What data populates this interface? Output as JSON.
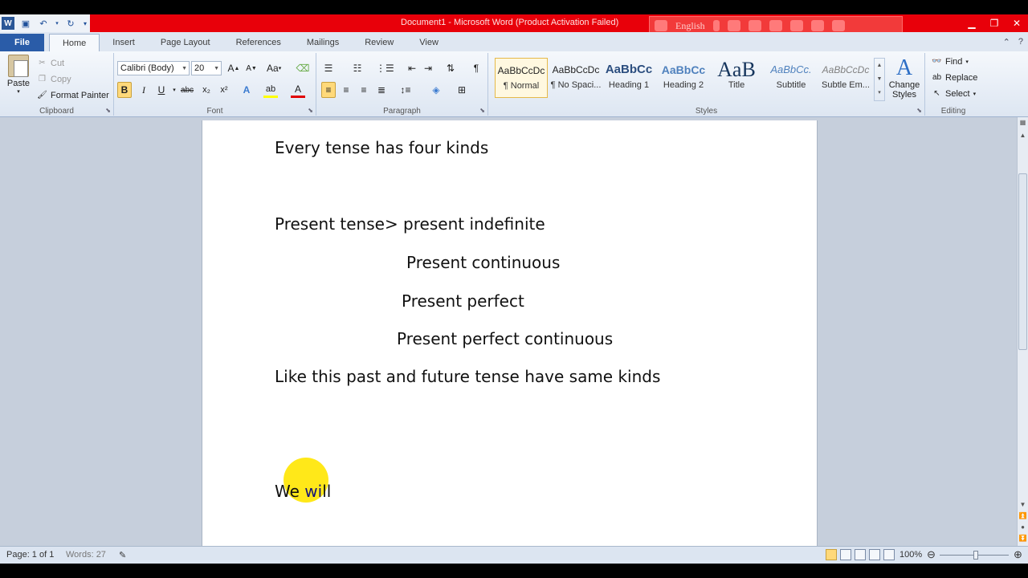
{
  "title_bar": {
    "title": "Document1  -  Microsoft Word (Product Activation Failed)",
    "language": "English"
  },
  "tabs": [
    "File",
    "Home",
    "Insert",
    "Page Layout",
    "References",
    "Mailings",
    "Review",
    "View"
  ],
  "active_tab": "Home",
  "clipboard": {
    "paste": "Paste",
    "cut": "Cut",
    "copy": "Copy",
    "format_painter": "Format Painter",
    "group_label": "Clipboard"
  },
  "font": {
    "family": "Calibri (Body)",
    "size": "20",
    "change_case": "Aa",
    "group_label": "Font"
  },
  "paragraph": {
    "group_label": "Paragraph"
  },
  "styles": {
    "items": [
      {
        "sample": "AaBbCcDc",
        "name": "¶ Normal"
      },
      {
        "sample": "AaBbCcDc",
        "name": "¶ No Spaci..."
      },
      {
        "sample": "AaBbCc",
        "name": "Heading 1"
      },
      {
        "sample": "AaBbCc",
        "name": "Heading 2"
      },
      {
        "sample": "AaB",
        "name": "Title"
      },
      {
        "sample": "AaBbCc.",
        "name": "Subtitle"
      },
      {
        "sample": "AaBbCcDc",
        "name": "Subtle Em..."
      }
    ],
    "change_styles": "Change Styles",
    "group_label": "Styles"
  },
  "editing": {
    "find": "Find",
    "replace": "Replace",
    "select": "Select",
    "group_label": "Editing"
  },
  "document": {
    "line1": "Every tense has four kinds",
    "line2": "Present tense> present indefinite",
    "line3": "Present continuous",
    "line4": "Present perfect",
    "line5": "Present perfect continuous",
    "line6": "Like this past and future tense have same kinds",
    "typing_part1": "We ",
    "typing_part2": "wi",
    "typing_part3": "ll"
  },
  "status_bar": {
    "page": "Page: 1 of 1",
    "words": "Words: 27",
    "zoom": "100%"
  },
  "colors": {
    "title_bar": "#e8000a",
    "file_tab": "#2a5ca8",
    "ribbon": "#dde6f2",
    "cursor_highlight": "#ffe600"
  }
}
